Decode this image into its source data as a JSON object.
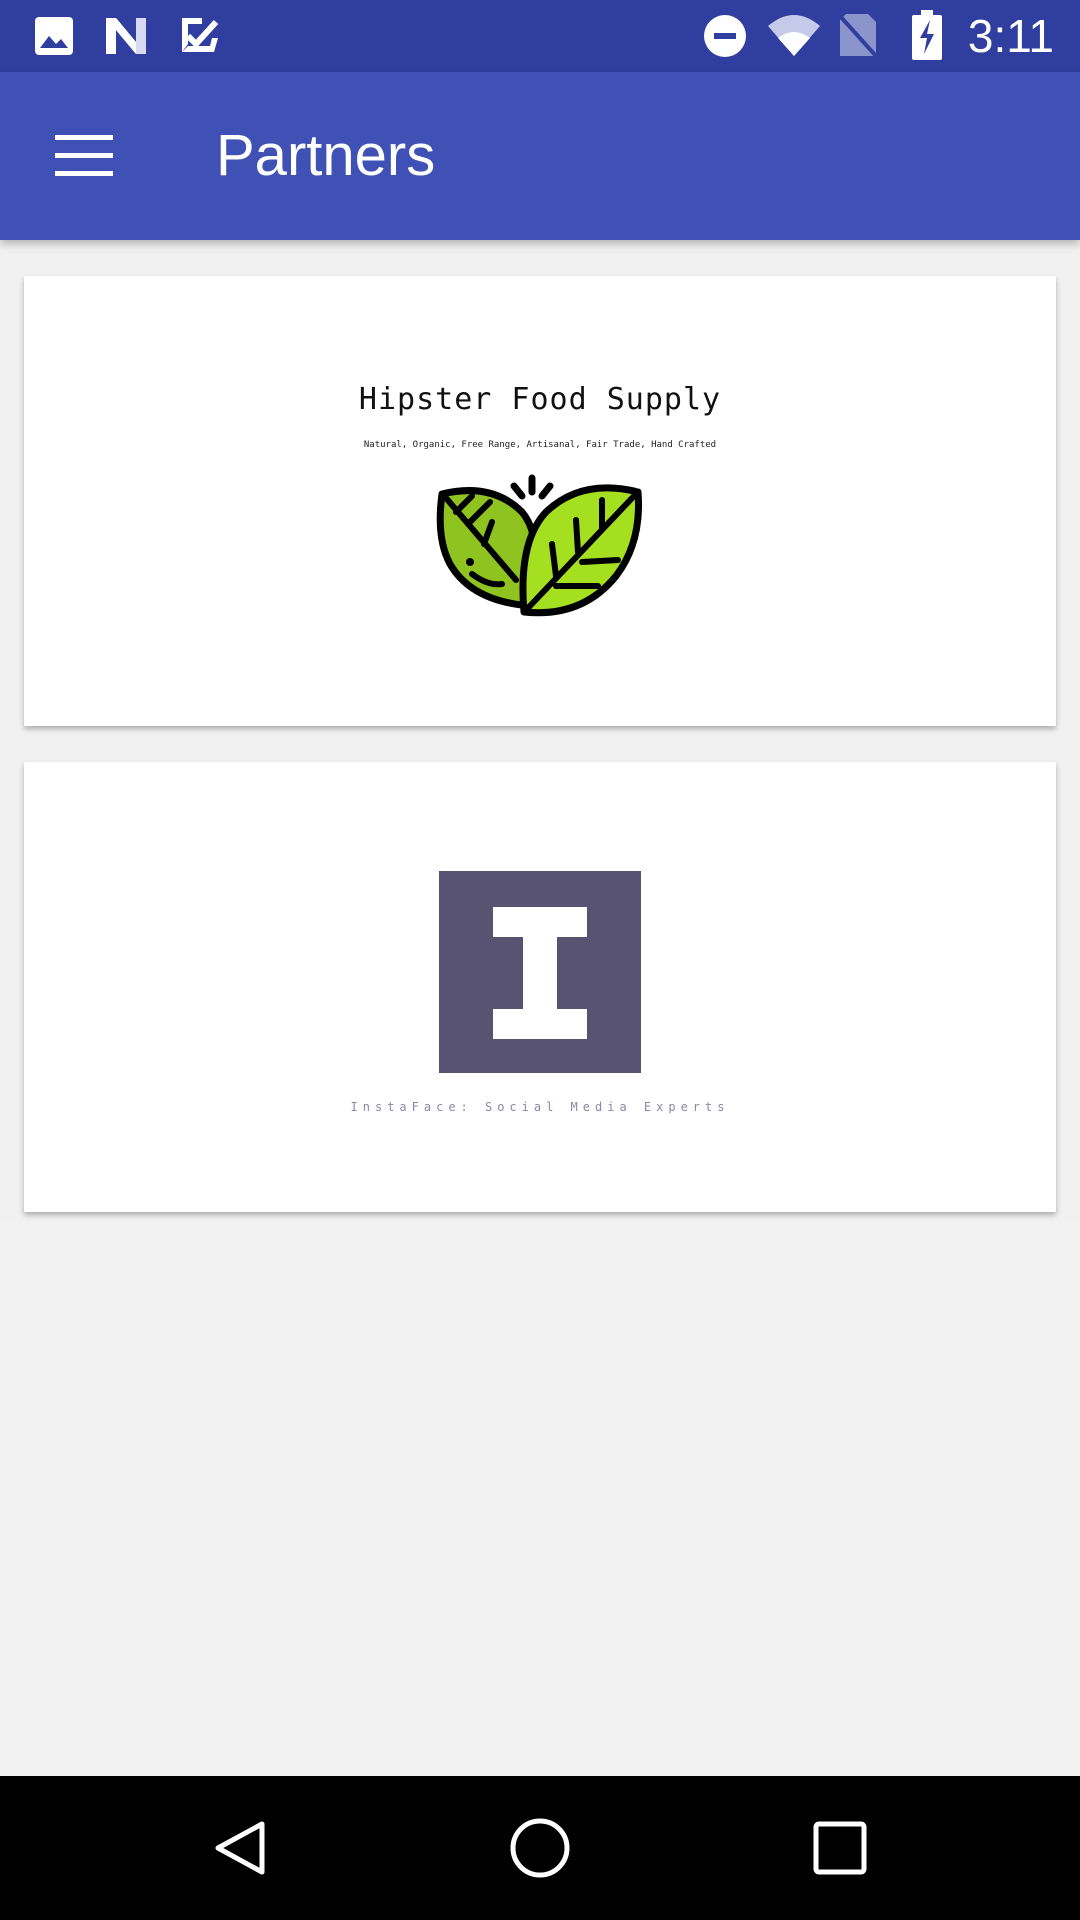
{
  "status_bar": {
    "time": "3:11",
    "left_icons": [
      "image-icon",
      "n-logo-icon",
      "task-check-icon"
    ],
    "right_icons": [
      "do-not-disturb-icon",
      "wifi-icon",
      "no-sim-icon",
      "battery-charging-icon"
    ],
    "color": "#303f9f"
  },
  "app_bar": {
    "title": "Partners",
    "menu_icon": "menu-icon",
    "color": "#3f51b5"
  },
  "partners": [
    {
      "name": "Hipster Food Supply",
      "tagline": "Natural, Organic, Free Range, Artisanal, Fair Trade, Hand Crafted",
      "logo": "leaves-icon",
      "accent": "#a4e01f"
    },
    {
      "name": "InstaFace: Social Media Experts",
      "logo": "letter-i-logo",
      "accent": "#575370"
    }
  ],
  "nav_bar": {
    "buttons": [
      "back-icon",
      "home-icon",
      "recents-icon"
    ]
  }
}
